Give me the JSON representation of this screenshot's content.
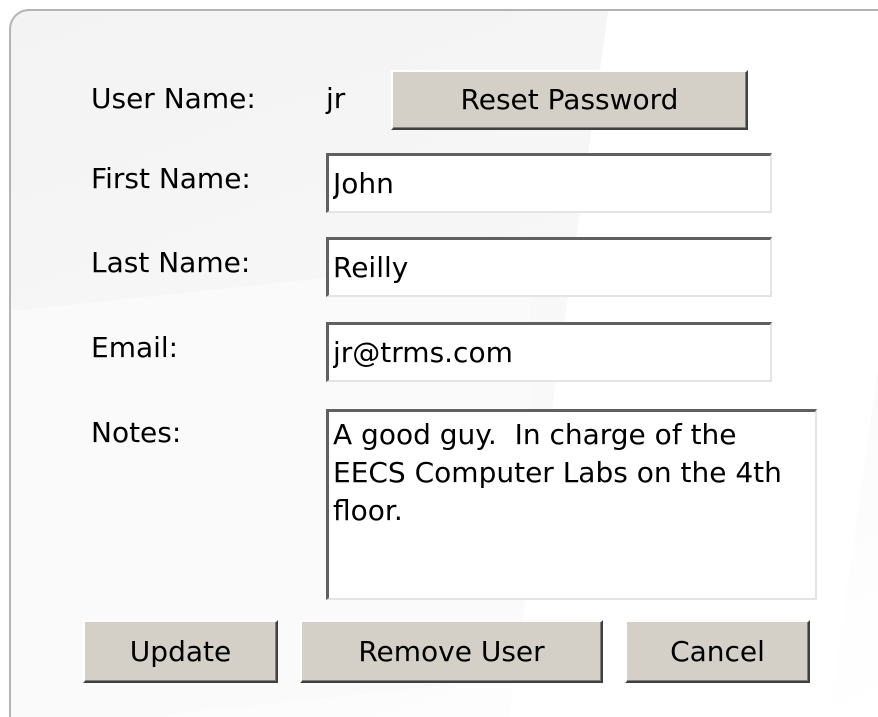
{
  "form": {
    "username_label": "User Name:",
    "username_value": "jr",
    "reset_password_label": "Reset Password",
    "first_name_label": "First Name:",
    "first_name_value": "John",
    "last_name_label": "Last Name:",
    "last_name_value": "Reilly",
    "email_label": "Email:",
    "email_value": "jr@trms.com",
    "notes_label": "Notes:",
    "notes_value": "A good guy.  In charge of the EECS Computer Labs on the 4th floor."
  },
  "actions": {
    "update_label": "Update",
    "remove_user_label": "Remove User",
    "cancel_label": "Cancel"
  }
}
